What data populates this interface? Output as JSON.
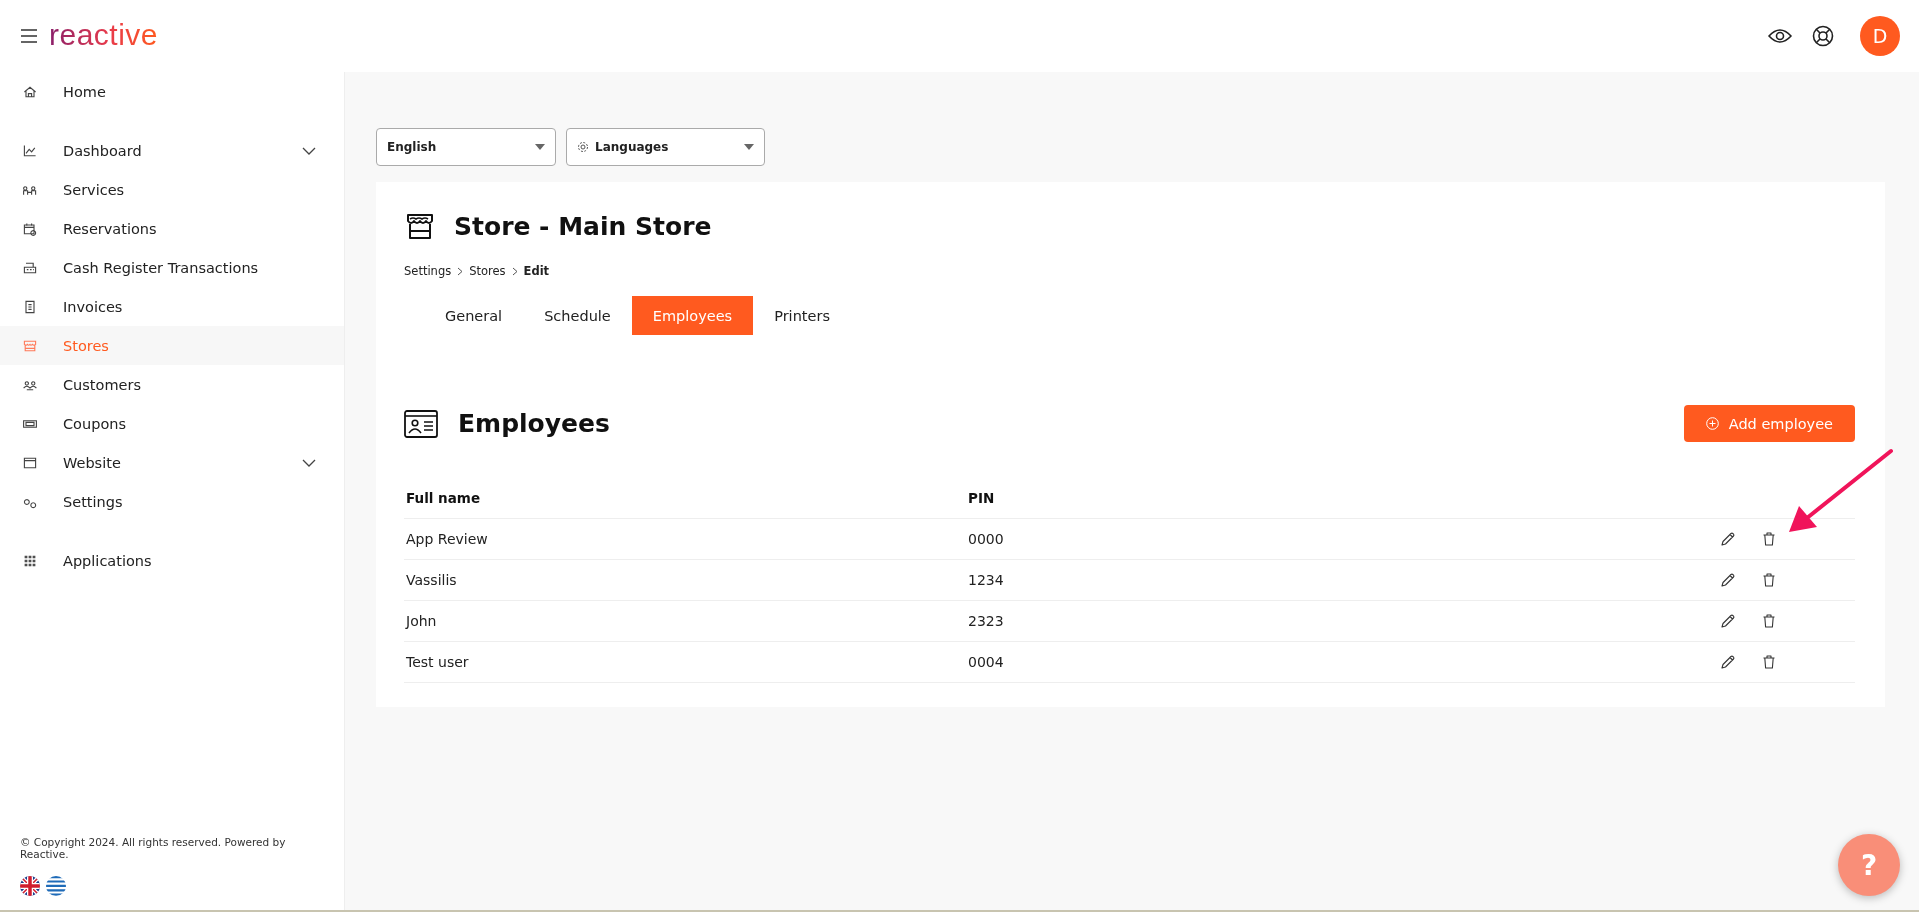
{
  "header": {
    "logo": "reactive",
    "avatar": "D"
  },
  "sidebar": {
    "sections": [
      [
        {
          "label": "Home",
          "kind": "link",
          "selected": false
        }
      ],
      [
        {
          "label": "Dashboard",
          "kind": "group",
          "selected": false
        },
        {
          "label": "Services",
          "kind": "link",
          "selected": false
        },
        {
          "label": "Reservations",
          "kind": "link",
          "selected": false
        },
        {
          "label": "Cash Register Transactions",
          "kind": "link",
          "selected": false
        },
        {
          "label": "Invoices",
          "kind": "link",
          "selected": false
        },
        {
          "label": "Stores",
          "kind": "link",
          "selected": true
        },
        {
          "label": "Customers",
          "kind": "link",
          "selected": false
        },
        {
          "label": "Coupons",
          "kind": "link",
          "selected": false
        },
        {
          "label": "Website",
          "kind": "group",
          "selected": false
        },
        {
          "label": "Settings",
          "kind": "link",
          "selected": false
        }
      ],
      [
        {
          "label": "Applications",
          "kind": "link",
          "selected": false
        }
      ]
    ],
    "footer": "© Copyright 2024. All rights reserved. Powered by Reactive."
  },
  "selects": [
    {
      "value": "English"
    },
    {
      "value": "Languages"
    }
  ],
  "page": {
    "title": "Store - Main Store",
    "breadcrumb": [
      "Settings",
      "Stores",
      "Edit"
    ],
    "tabs": [
      {
        "label": "General",
        "selected": false
      },
      {
        "label": "Schedule",
        "selected": false
      },
      {
        "label": "Employees",
        "selected": true
      },
      {
        "label": "Printers",
        "selected": false
      }
    ]
  },
  "section": {
    "title": "Employees",
    "add_button": "Add employee"
  },
  "table": {
    "columns": [
      "Full name",
      "PIN"
    ],
    "rows": [
      {
        "full_name": "App Review",
        "pin": "0000"
      },
      {
        "full_name": "Vassilis",
        "pin": "1234"
      },
      {
        "full_name": "John",
        "pin": "2323"
      },
      {
        "full_name": "Test user",
        "pin": "0004"
      }
    ]
  },
  "help_button": "?"
}
